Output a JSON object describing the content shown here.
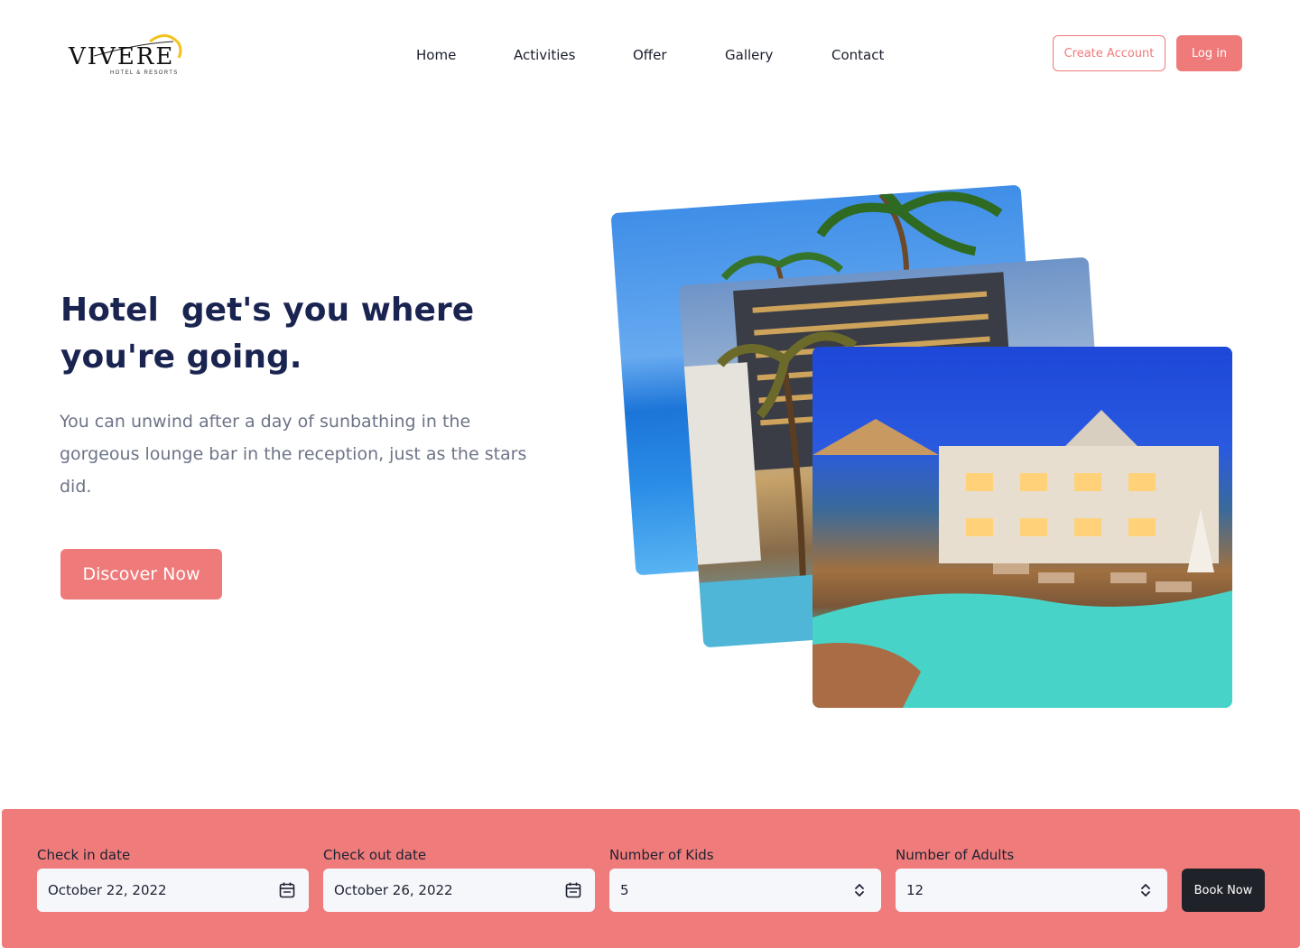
{
  "brand": {
    "logo_text": "VIVERE",
    "logo_tagline": "HOTEL & RESORTS"
  },
  "nav": {
    "items": [
      "Home",
      "Activities",
      "Offer",
      "Gallery",
      "Contact"
    ]
  },
  "header_actions": {
    "create_account": "Create Account",
    "login": "Log in"
  },
  "hero": {
    "title": "Hotel  get's you where you're going.",
    "text": "You can unwind after a day of sunbathing in the gorgeous lounge bar in the reception, just as the stars did.",
    "cta": "Discover Now"
  },
  "booking": {
    "check_in": {
      "label": "Check in date",
      "value": "October 22, 2022",
      "icon": "calendar-icon"
    },
    "check_out": {
      "label": "Check out date",
      "value": "October 26, 2022",
      "icon": "calendar-icon"
    },
    "kids": {
      "label": "Number of Kids",
      "value": "5",
      "icon": "up-down-chevron-icon"
    },
    "adults": {
      "label": "Number of Adults",
      "value": "12",
      "icon": "up-down-chevron-icon"
    },
    "submit": "Book Now"
  },
  "colors": {
    "accent": "#ef7a7a",
    "heading": "#1a2450",
    "body_text": "#6d7487",
    "dark_button": "#1f2229"
  }
}
